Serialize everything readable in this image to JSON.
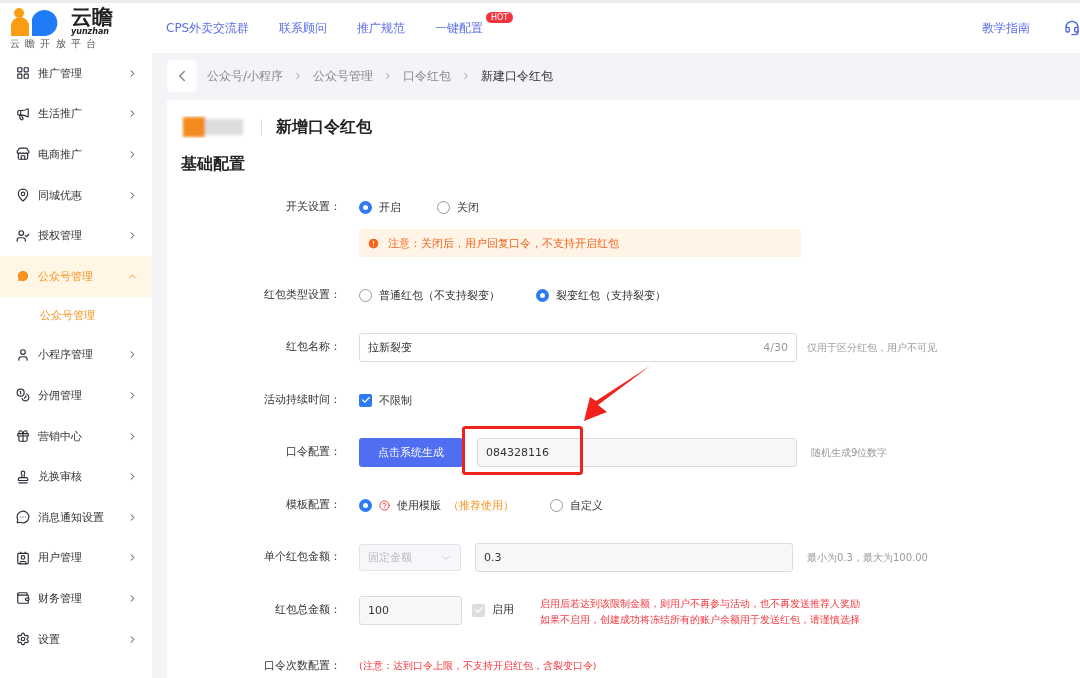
{
  "header": {
    "logo": {
      "name": "云瞻",
      "latin": "yunzhan",
      "tagline": "云 瞻 开 放 平 台"
    },
    "nav": [
      {
        "label": "CPS外卖交流群"
      },
      {
        "label": "联系顾问"
      },
      {
        "label": "推广规范"
      },
      {
        "label": "一键配置",
        "badge": "HOT"
      }
    ],
    "right_link": "教学指南"
  },
  "sidebar": {
    "items": [
      {
        "label": "推广管理",
        "expanded": false,
        "selected": false
      },
      {
        "label": "生活推广",
        "expanded": false,
        "selected": false
      },
      {
        "label": "电商推广",
        "expanded": false,
        "selected": false
      },
      {
        "label": "同城优惠",
        "expanded": false,
        "selected": false
      },
      {
        "label": "授权管理",
        "expanded": false,
        "selected": false
      },
      {
        "label": "公众号管理",
        "expanded": true,
        "selected": true,
        "children": [
          {
            "label": "公众号管理",
            "selected": true
          }
        ]
      },
      {
        "label": "小程序管理",
        "expanded": false,
        "selected": false
      },
      {
        "label": "分佣管理",
        "expanded": false,
        "selected": false
      },
      {
        "label": "营销中心",
        "expanded": false,
        "selected": false
      },
      {
        "label": "兑换审核",
        "expanded": false,
        "selected": false
      },
      {
        "label": "消息通知设置",
        "expanded": false,
        "selected": false
      },
      {
        "label": "用户管理",
        "expanded": false,
        "selected": false
      },
      {
        "label": "财务管理",
        "expanded": false,
        "selected": false
      },
      {
        "label": "设置",
        "expanded": false,
        "selected": false
      }
    ]
  },
  "breadcrumb": [
    "公众号/小程序",
    "公众号管理",
    "口令红包",
    "新建口令红包"
  ],
  "page_title": "新增口令红包",
  "section_title": "基础配置",
  "form": [
    {
      "kind": "radio",
      "label": "开关设置：",
      "options": [
        {
          "label": "开启",
          "selected": true
        },
        {
          "label": "关闭",
          "selected": false
        }
      ],
      "notice": "注意：关闭后，用户回复口令，不支持开启红包"
    },
    {
      "kind": "radio",
      "label": "红包类型设置：",
      "options": [
        {
          "label": "普通红包（不支持裂变）",
          "selected": false
        },
        {
          "label": "裂变红包（支持裂变）",
          "selected": true
        }
      ]
    },
    {
      "kind": "text",
      "label": "红包名称：",
      "value": "拉新裂变",
      "counter": "4/30",
      "hint": "仅用于区分红包，用户不可见"
    },
    {
      "kind": "checkbox",
      "label": "活动持续时间：",
      "option": "不限制",
      "checked": true
    },
    {
      "kind": "generate",
      "label": "口令配置：",
      "button": "点击系统生成",
      "value": "084328116",
      "hint": "随机生成9位数字"
    },
    {
      "kind": "template",
      "label": "模板配置：",
      "options": [
        {
          "label": "使用模版",
          "note": "（推荐使用）",
          "selected": true
        },
        {
          "label": "自定义",
          "selected": false
        }
      ]
    },
    {
      "kind": "amount",
      "label": "单个红包金额：",
      "select": "固定金额",
      "value": "0.3",
      "hint": "最小为0.3，最大为100.00"
    },
    {
      "kind": "total",
      "label": "红包总金额：",
      "value": "100",
      "option": "启用",
      "checked": true,
      "disabled": true,
      "warnings": [
        "启用后若达到该限制金额，则用户不再参与活动，也不再发送推荐人奖励",
        "如果不启用，创建成功将冻结所有的账户余额用于发送红包，请谨慎选择"
      ]
    },
    {
      "kind": "note",
      "label": "口令次数配置：",
      "note": "(注意：达到口令上限，不支持开启红包，含裂变口令)"
    }
  ]
}
